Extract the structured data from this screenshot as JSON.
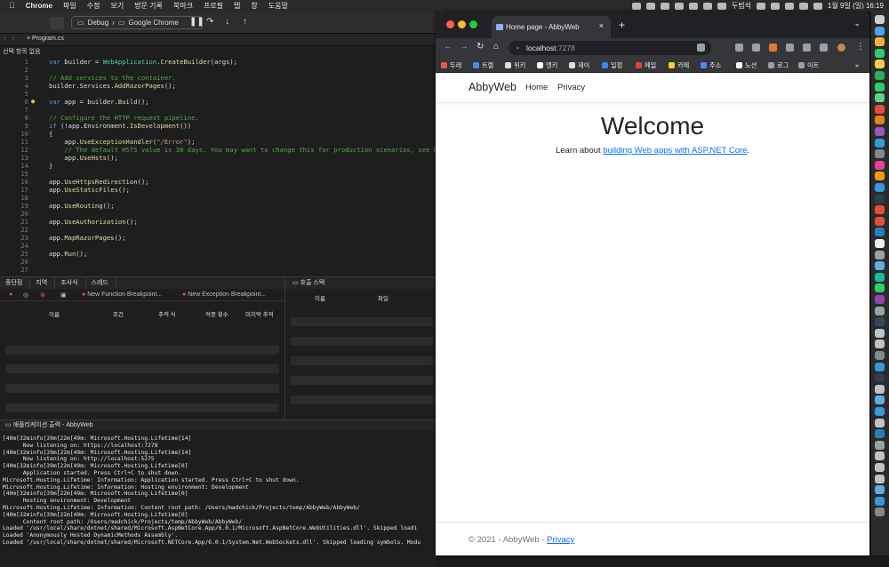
{
  "menubar": {
    "app_name": "Chrome",
    "items": [
      "파일",
      "수정",
      "보기",
      "방문 기록",
      "북마크",
      "프로필",
      "탭",
      "창",
      "도움말"
    ],
    "tray_user": "두범석",
    "clock": "1월 9일 (일)  16:19"
  },
  "ide": {
    "run_config": "Debug",
    "run_target": "Google Chrome",
    "open_tab": "Program.cs",
    "breadcrumb": "선택 항목 없음",
    "code_lines": [
      {
        "n": "1",
        "parts": [
          [
            "c-kw",
            "var"
          ],
          [
            "c-pl",
            " builder = "
          ],
          [
            "c-tp",
            "WebApplication"
          ],
          [
            "c-pl",
            "."
          ],
          [
            "c-mt",
            "CreateBuilder"
          ],
          [
            "c-pl",
            "(args);"
          ]
        ]
      },
      {
        "n": "2",
        "parts": []
      },
      {
        "n": "3",
        "parts": [
          [
            "c-cm",
            "// Add services to the container."
          ]
        ]
      },
      {
        "n": "4",
        "parts": [
          [
            "c-pl",
            "builder.Services."
          ],
          [
            "c-mt",
            "AddRazorPages"
          ],
          [
            "c-pl",
            "();"
          ]
        ]
      },
      {
        "n": "5",
        "parts": []
      },
      {
        "n": "6",
        "parts": [
          [
            "c-kw",
            "var"
          ],
          [
            "c-pl",
            " app = builder."
          ],
          [
            "c-mt",
            "Build"
          ],
          [
            "c-pl",
            "();"
          ]
        ]
      },
      {
        "n": "7",
        "parts": []
      },
      {
        "n": "8",
        "parts": [
          [
            "c-cm",
            "// Configure the HTTP request pipeline."
          ]
        ]
      },
      {
        "n": "9",
        "parts": [
          [
            "c-kw",
            "if"
          ],
          [
            "c-pl",
            " (!app.Environment."
          ],
          [
            "c-mt",
            "IsDevelopment"
          ],
          [
            "c-pl",
            "())"
          ]
        ]
      },
      {
        "n": "10",
        "parts": [
          [
            "c-pl",
            "{"
          ]
        ]
      },
      {
        "n": "11",
        "parts": [
          [
            "c-pl",
            "    app."
          ],
          [
            "c-mt",
            "UseExceptionHandler"
          ],
          [
            "c-pl",
            "("
          ],
          [
            "c-st",
            "\"/Error\""
          ],
          [
            "c-pl",
            ");"
          ]
        ]
      },
      {
        "n": "12",
        "parts": [
          [
            "c-cm",
            "    // The default HSTS value is 30 days. You may want to change this for production scenarios, see h"
          ]
        ]
      },
      {
        "n": "13",
        "parts": [
          [
            "c-pl",
            "    app."
          ],
          [
            "c-mt",
            "UseHsts"
          ],
          [
            "c-pl",
            "();"
          ]
        ]
      },
      {
        "n": "14",
        "parts": [
          [
            "c-pl",
            "}"
          ]
        ]
      },
      {
        "n": "15",
        "parts": []
      },
      {
        "n": "16",
        "parts": [
          [
            "c-pl",
            "app."
          ],
          [
            "c-mt",
            "UseHttpsRedirection"
          ],
          [
            "c-pl",
            "();"
          ]
        ]
      },
      {
        "n": "17",
        "parts": [
          [
            "c-pl",
            "app."
          ],
          [
            "c-mt",
            "UseStaticFiles"
          ],
          [
            "c-pl",
            "();"
          ]
        ]
      },
      {
        "n": "18",
        "parts": []
      },
      {
        "n": "19",
        "parts": [
          [
            "c-pl",
            "app."
          ],
          [
            "c-mt",
            "UseRouting"
          ],
          [
            "c-pl",
            "();"
          ]
        ]
      },
      {
        "n": "20",
        "parts": []
      },
      {
        "n": "21",
        "parts": [
          [
            "c-pl",
            "app."
          ],
          [
            "c-mt",
            "UseAuthorization"
          ],
          [
            "c-pl",
            "();"
          ]
        ]
      },
      {
        "n": "22",
        "parts": []
      },
      {
        "n": "23",
        "parts": [
          [
            "c-pl",
            "app."
          ],
          [
            "c-mt",
            "MapRazorPages"
          ],
          [
            "c-pl",
            "();"
          ]
        ]
      },
      {
        "n": "24",
        "parts": []
      },
      {
        "n": "25",
        "parts": [
          [
            "c-pl",
            "app."
          ],
          [
            "c-mt",
            "Run"
          ],
          [
            "c-pl",
            "();"
          ]
        ]
      },
      {
        "n": "26",
        "parts": []
      },
      {
        "n": "27",
        "parts": []
      }
    ],
    "debug_tabs": [
      "중단점",
      "지역",
      "조사식",
      "스레드"
    ],
    "bp_tools": [
      "New Function Breakpoint...",
      "New Exception Breakpoint..."
    ],
    "bp_columns": [
      "이름",
      "조건",
      "추적 식",
      "적중 횟수",
      "미지막 추적"
    ],
    "callstack_title": "호출 스택",
    "callstack_columns": [
      "이름",
      "파일"
    ],
    "output_title": "애플리케이션 출력 - AbbyWeb",
    "output_lines": [
      "[40m[32minfo[39m[22m[49m: Microsoft.Hosting.Lifetime[14]",
      "      Now listening on: https://localhost:7278",
      "[40m[32minfo[39m[22m[49m: Microsoft.Hosting.Lifetime[14]",
      "      Now listening on: http://localhost:5275",
      "[40m[32minfo[39m[22m[49m: Microsoft.Hosting.Lifetime[0]",
      "      Application started. Press Ctrl+C to shut down.",
      "Microsoft.Hosting.Lifetime: Information: Application started. Press Ctrl+C to shut down.",
      "Microsoft.Hosting.Lifetime: Information: Hosting environment: Development",
      "[40m[32minfo[39m[22m[49m: Microsoft.Hosting.Lifetime[0]",
      "      Hosting environment: Development",
      "Microsoft.Hosting.Lifetime: Information: Content root path: /Users/madchick/Projects/temp/AbbyWeb/AbbyWeb/",
      "[40m[32minfo[39m[22m[49m: Microsoft.Hosting.Lifetime[0]",
      "      Content root path: /Users/madchick/Projects/temp/AbbyWeb/AbbyWeb/",
      "Loaded '/usr/local/share/dotnet/shared/Microsoft.AspNetCore.App/6.0.1/Microsoft.AspNetCore.WebUtilities.dll'. Skipped loadi",
      "Loaded 'Anonymously Hosted DynamicMethods Assembly'.",
      "Loaded '/usr/local/share/dotnet/shared/Microsoft.NETCore.App/6.0.1/System.Net.WebSockets.dll'. Skipped loading symbols. Modu"
    ]
  },
  "browser": {
    "tab_title": "Home page - AbbyWeb",
    "url_host": "localhost",
    "url_port": ":7278",
    "bookmarks": [
      {
        "label": "두레",
        "color": "#e8594f"
      },
      {
        "label": "트렐",
        "color": "#4c8bf5"
      },
      {
        "label": "위키",
        "color": "#dddddd"
      },
      {
        "label": "엥키",
        "color": "#ffffff"
      },
      {
        "label": "제이",
        "color": "#dddddd"
      },
      {
        "label": "일정",
        "color": "#4285f4"
      },
      {
        "label": "메일",
        "color": "#ea4335"
      },
      {
        "label": "카페",
        "color": "#f7cf33"
      },
      {
        "label": "주소",
        "color": "#4c8bf5"
      },
      {
        "label": "노션",
        "color": "#ffffff"
      },
      {
        "label": "로그",
        "color": "#9aa0a6"
      },
      {
        "label": "이트",
        "color": "#9aa0a6"
      }
    ]
  },
  "site": {
    "brand": "AbbyWeb",
    "nav": [
      "Home",
      "Privacy"
    ],
    "heading": "Welcome",
    "learn_prefix": "Learn about ",
    "learn_link": "building Web apps with ASP.NET Core",
    "learn_suffix": ".",
    "footer_text": "© 2021 - AbbyWeb - ",
    "footer_link": "Privacy"
  },
  "colors": {
    "link": "#0d6efd",
    "ide_bg": "#1e1e1e",
    "chrome_dark": "#35363a"
  }
}
